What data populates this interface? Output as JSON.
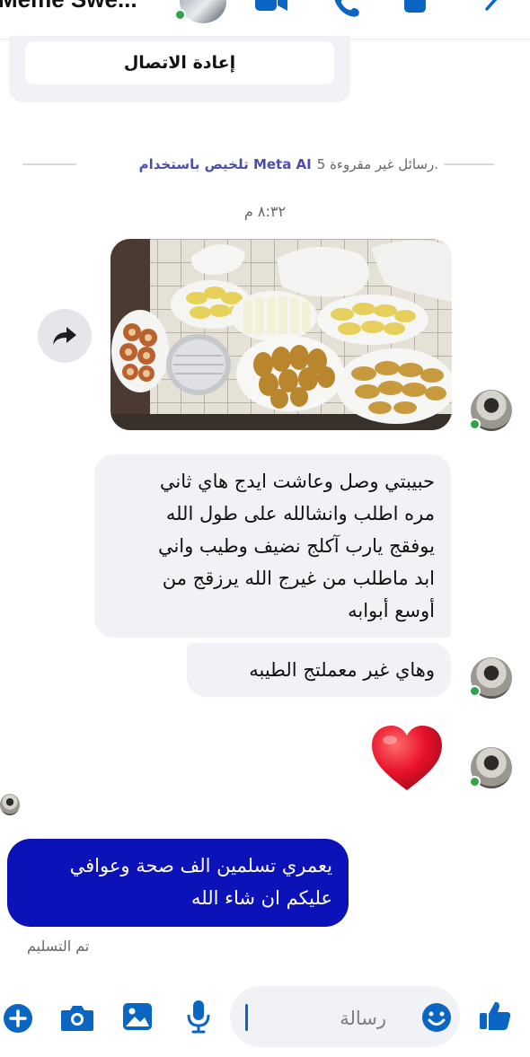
{
  "header": {
    "contact_name": "Meme Swe..."
  },
  "reconnect": {
    "label": "إعادة الاتصال"
  },
  "unread_divider": {
    "count_text": "5 رسائل غير مقروءة.",
    "link_text": "تلخيص باستخدام Meta AI"
  },
  "timestamp": "٨:٣٢ م",
  "messages": {
    "received_1": {
      "lines": [
        "حبيبتي وصل وعاشت ايدج هاي ثاني",
        "مره اطلب وانشالله على طول الله",
        "يوفقج يارب آكلج نضيف وطيب واني",
        "ابد ماطلب من غيرج الله يرزقج من",
        "أوسع أبوابه"
      ]
    },
    "received_2": "وهاي غير معملتج الطيبه",
    "sent_1": {
      "lines": [
        "يعمري تسلمين الف صحة وعوافي",
        "عليكم ان شاء الله"
      ]
    }
  },
  "status": {
    "delivered": "تم التسليم"
  },
  "composer": {
    "placeholder": "رسالة"
  },
  "icons": {
    "header": [
      "video-call-icon",
      "voice-call-icon",
      "info-icon",
      "chevron-icon"
    ],
    "composer": [
      "plus-icon",
      "camera-icon",
      "gallery-icon",
      "microphone-icon",
      "emoji-icon",
      "like-icon"
    ]
  },
  "colors": {
    "accent": "#0a66c2",
    "sent_bubble": "#0a12b8",
    "received_bubble": "#f0f2f5",
    "presence": "#31a24c",
    "heart": "#e8132a"
  }
}
